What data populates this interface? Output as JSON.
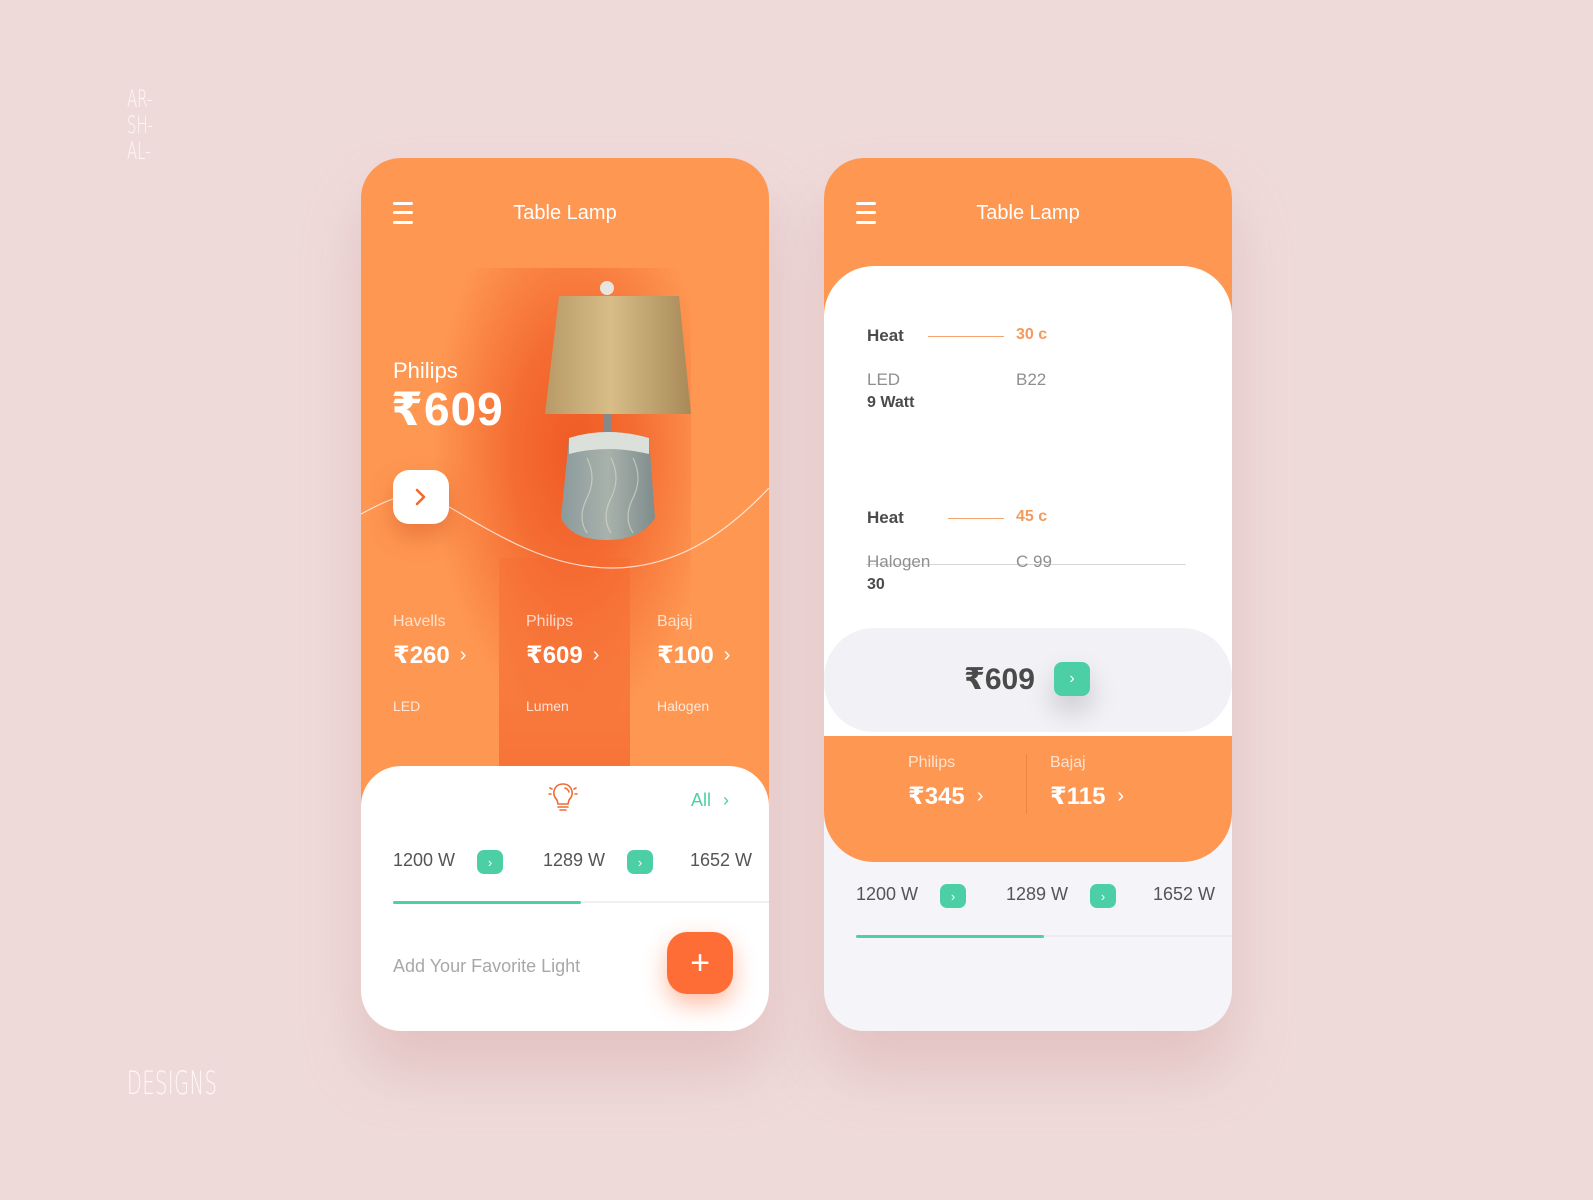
{
  "branding": {
    "lines": [
      "AR-",
      "SH-",
      "AL-"
    ],
    "footer": "DESIGNS"
  },
  "colors": {
    "background": "#efdada",
    "orange": "#fe9752",
    "deep_orange": "#f4652e",
    "accent_green": "#4ccfa4",
    "fab": "#fe6d36",
    "heat_value": "#f39a5d"
  },
  "card1": {
    "title": "Table Lamp",
    "menu_icon": "hamburger-menu-icon",
    "hero": {
      "brand": "Philips",
      "price": "₹609",
      "next_icon": "chevron-right-icon"
    },
    "brands": [
      {
        "name": "Havells",
        "price": "₹260",
        "type": "LED",
        "selected": false
      },
      {
        "name": "Philips",
        "price": "₹609",
        "type": "Lumen",
        "selected": true
      },
      {
        "name": "Bajaj",
        "price": "₹100",
        "type": "Halogen",
        "selected": false
      }
    ],
    "panel": {
      "icon": "light-bulb-icon",
      "all_label": "All",
      "watts": [
        "1200 W",
        "1289 W",
        "1652 W"
      ],
      "progress": 0.5,
      "add_label": "Add Your Favorite Light",
      "fab_label": "+"
    }
  },
  "card2": {
    "title": "Table Lamp",
    "menu_icon": "hamburger-menu-icon",
    "specs": [
      {
        "heat_label": "Heat",
        "heat_value": "30 c",
        "type": "LED",
        "code": "B22",
        "sub": "9 Watt"
      },
      {
        "heat_label": "Heat",
        "heat_value": "45 c",
        "type": "Halogen",
        "code": "C 99",
        "sub": "30"
      }
    ],
    "price": "₹609",
    "brands": [
      {
        "name": "Philips",
        "price": "₹345"
      },
      {
        "name": "Bajaj",
        "price": "₹115"
      }
    ],
    "watts": [
      "1200 W",
      "1289 W",
      "1652 W"
    ],
    "progress": 0.5
  },
  "chevron": "›"
}
